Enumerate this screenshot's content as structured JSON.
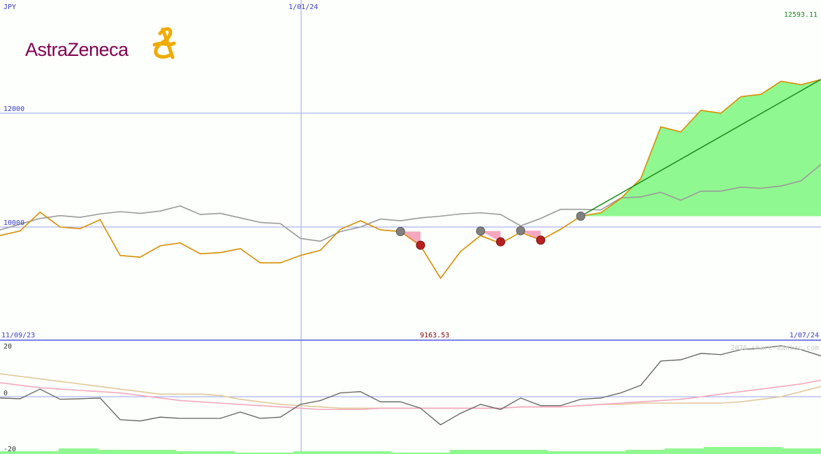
{
  "header": {
    "currency": "JPY",
    "date_mid": "1/01/24",
    "last_value": "12593.11"
  },
  "logo": {
    "text": "AstraZeneca"
  },
  "footer": {
    "date_start": "11/09/23",
    "low_value": "9163.53",
    "date_end": "1/07/24",
    "watermark": "2026 share-maniac.com"
  },
  "colors": {
    "background": "#fcfffb",
    "grid": "#9aa0f0",
    "price": "#d98c00",
    "benchmark": "#9a9a9a",
    "fill": "#90f890",
    "trend": "#1a8a1a",
    "marker_grey": "#808080",
    "marker_red": "#b82020",
    "pink": "#f4a8c0",
    "osc_main": "#606060",
    "osc_pink": "#f4a8c0",
    "osc_tan": "#e2c89a",
    "vol": "#90f890",
    "label_blue": "#3a3ad0",
    "label_green": "#1a8a1a",
    "label_red": "#8b0000",
    "brand": "#830051"
  },
  "chart_data": [
    {
      "type": "line",
      "title": "",
      "ylabel": "JPY",
      "ylim": [
        9163.53,
        12593.11
      ],
      "y_ticks": [
        10000,
        12000
      ],
      "x_range": [
        "11/09/23",
        "1/07/24"
      ],
      "x_marker": "1/01/24",
      "series": [
        {
          "name": "",
          "values": [
            9850,
            9930,
            10260,
            10000,
            9970,
            10130,
            9500,
            9470,
            9670,
            9720,
            9530,
            9550,
            9620,
            9370,
            9370,
            9500,
            9590,
            9960,
            10110,
            9950,
            9920,
            9670,
            9100,
            9570,
            9850,
            9710,
            9910,
            9770,
            9960,
            10190,
            10250,
            10500,
            10850,
            11760,
            11670,
            12050,
            12000,
            12290,
            12330,
            12560,
            12500,
            12590
          ]
        },
        {
          "name": "",
          "values": [
            9950,
            10050,
            10150,
            10200,
            10170,
            10230,
            10270,
            10240,
            10280,
            10370,
            10220,
            10240,
            10160,
            10080,
            10060,
            9800,
            9750,
            9920,
            10000,
            10140,
            10110,
            10160,
            10190,
            10230,
            10250,
            10220,
            10020,
            10150,
            10310,
            10310,
            10300,
            10510,
            10530,
            10610,
            10470,
            10630,
            10630,
            10700,
            10680,
            10720,
            10810,
            11100
          ]
        }
      ],
      "trend_line": {
        "from": [
          29,
          10190
        ],
        "to": [
          41,
          12593.11
        ]
      },
      "markers": [
        {
          "kind": "grey",
          "x": 20,
          "y": 9920
        },
        {
          "kind": "red",
          "x": 21,
          "y": 9680
        },
        {
          "kind": "grey",
          "x": 24,
          "y": 9930
        },
        {
          "kind": "red",
          "x": 25,
          "y": 9740
        },
        {
          "kind": "grey",
          "x": 26,
          "y": 9935
        },
        {
          "kind": "red",
          "x": 27,
          "y": 9770
        },
        {
          "kind": "grey",
          "x": 29,
          "y": 10190
        }
      ]
    },
    {
      "type": "line",
      "title": "",
      "ylim": [
        -20,
        20
      ],
      "y_ticks": [
        20,
        0,
        -20
      ],
      "series": [
        {
          "name": "",
          "values": [
            -0.5,
            -0.8,
            3,
            -1,
            -0.8,
            -0.5,
            -9,
            -9.5,
            -8,
            -8.5,
            -8.5,
            -8.5,
            -6,
            -8.5,
            -8,
            -3,
            -1.5,
            1.5,
            2,
            -2,
            -2,
            -4.5,
            -11,
            -6.5,
            -3,
            -5,
            -0.5,
            -3.5,
            -3.5,
            -1,
            -0.5,
            1.5,
            4.5,
            14,
            14.5,
            17,
            16.5,
            18.5,
            19,
            20,
            18.5,
            16
          ]
        },
        {
          "name": "",
          "values": [
            5.5,
            4.5,
            3.5,
            3,
            2.5,
            2,
            1.5,
            0.5,
            -0.5,
            -1.5,
            -2,
            -2.5,
            -3,
            -3.5,
            -4,
            -4.5,
            -5,
            -5,
            -5,
            -4.5,
            -4.5,
            -4.5,
            -4.5,
            -4.5,
            -4.5,
            -4.5,
            -4,
            -4,
            -4,
            -3.5,
            -3,
            -2.5,
            -2,
            -1.5,
            -1,
            0,
            1,
            2,
            3,
            4,
            5,
            6.5
          ]
        },
        {
          "name": "",
          "values": [
            9,
            8,
            7,
            6,
            5,
            4,
            3,
            2,
            1,
            1,
            1,
            0.5,
            -1,
            -2,
            -3,
            -3.5,
            -4,
            -4.5,
            -4.5,
            -4.5,
            -4.5,
            -4.5,
            -4.5,
            -4.5,
            -4.5,
            -4.5,
            -4,
            -4,
            -4,
            -3.5,
            -3,
            -3,
            -2.5,
            -2.5,
            -2.5,
            -2.5,
            -2.5,
            -2,
            -1,
            0,
            2,
            4
          ]
        }
      ],
      "volume": [
        1,
        1,
        1,
        2,
        2,
        1.5,
        1.5,
        1.5,
        1.5,
        1,
        1,
        1,
        0.5,
        0.5,
        0.5,
        1,
        1,
        1,
        1,
        1,
        0.5,
        0.5,
        0.5,
        1.5,
        1.5,
        1.5,
        1.5,
        1.5,
        1,
        1,
        1,
        1,
        1.5,
        1.5,
        2,
        2,
        2.5,
        2.5,
        2.5,
        2.5,
        2,
        2
      ]
    }
  ]
}
